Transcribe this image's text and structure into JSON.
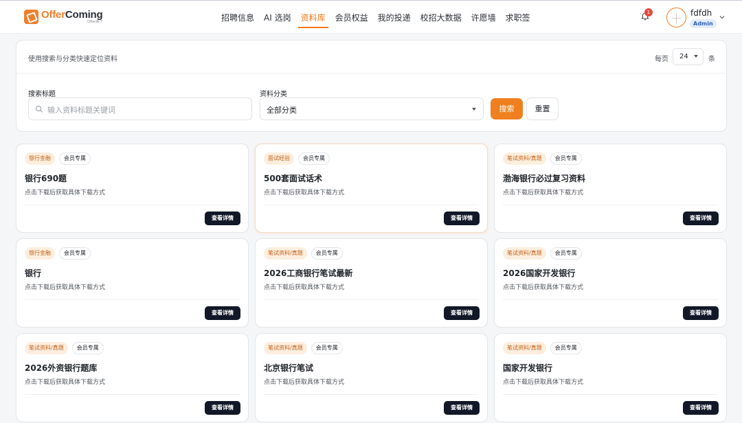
{
  "header": {
    "logo_name_a": "Offer",
    "logo_name_b": "Coming",
    "logo_sub": "Offer来了",
    "nav": [
      {
        "label": "招聘信息",
        "active": false
      },
      {
        "label": "AI 选岗",
        "active": false
      },
      {
        "label": "资料库",
        "active": true
      },
      {
        "label": "会员权益",
        "active": false
      },
      {
        "label": "我的投递",
        "active": false
      },
      {
        "label": "校招大数据",
        "active": false
      },
      {
        "label": "许愿墙",
        "active": false
      },
      {
        "label": "求职签",
        "active": false
      }
    ],
    "notification_count": "1",
    "username": "fdfdh",
    "role": "Admin",
    "accent": "#ef7a1a"
  },
  "filter": {
    "hint": "使用搜索与分类快速定位资料",
    "perpage_label": "每页",
    "perpage_value": "24",
    "perpage_unit": "条",
    "title_label": "搜索标题",
    "title_placeholder": "输入资料标题关键词",
    "category_label": "资料分类",
    "category_value": "全部分类",
    "search_button": "搜索",
    "reset_button": "重置"
  },
  "cards": [
    {
      "category": "银行金融",
      "member": "会员专属",
      "title": "银行690题",
      "desc": "点击下载后获取具体下载方式",
      "button": "查看详情"
    },
    {
      "category": "面试经验",
      "member": "会员专属",
      "title": "500套面试话术",
      "desc": "点击下载后获取具体下载方式",
      "button": "查看详情"
    },
    {
      "category": "笔试资料/真题",
      "member": "会员专属",
      "title": "渤海银行必过复习资料",
      "desc": "点击下载后获取具体下载方式",
      "button": "查看详情"
    },
    {
      "category": "银行金融",
      "member": "会员专属",
      "title": "银行",
      "desc": "点击下载后获取具体下载方式",
      "button": "查看详情"
    },
    {
      "category": "笔试资料/真题",
      "member": "会员专属",
      "title": "2026工商银行笔试最新",
      "desc": "点击下载后获取具体下载方式",
      "button": "查看详情"
    },
    {
      "category": "笔试资料/真题",
      "member": "会员专属",
      "title": "2026国家开发银行",
      "desc": "点击下载后获取具体下载方式",
      "button": "查看详情"
    },
    {
      "category": "笔试资料/真题",
      "member": "会员专属",
      "title": "2026外资银行题库",
      "desc": "点击下载后获取具体下载方式",
      "button": "查看详情"
    },
    {
      "category": "笔试资料/真题",
      "member": "会员专属",
      "title": "北京银行笔试",
      "desc": "点击下载后获取具体下载方式",
      "button": "查看详情"
    },
    {
      "category": "笔试资料/真题",
      "member": "会员专属",
      "title": "国家开发银行",
      "desc": "点击下载后获取具体下载方式",
      "button": "查看详情"
    }
  ]
}
